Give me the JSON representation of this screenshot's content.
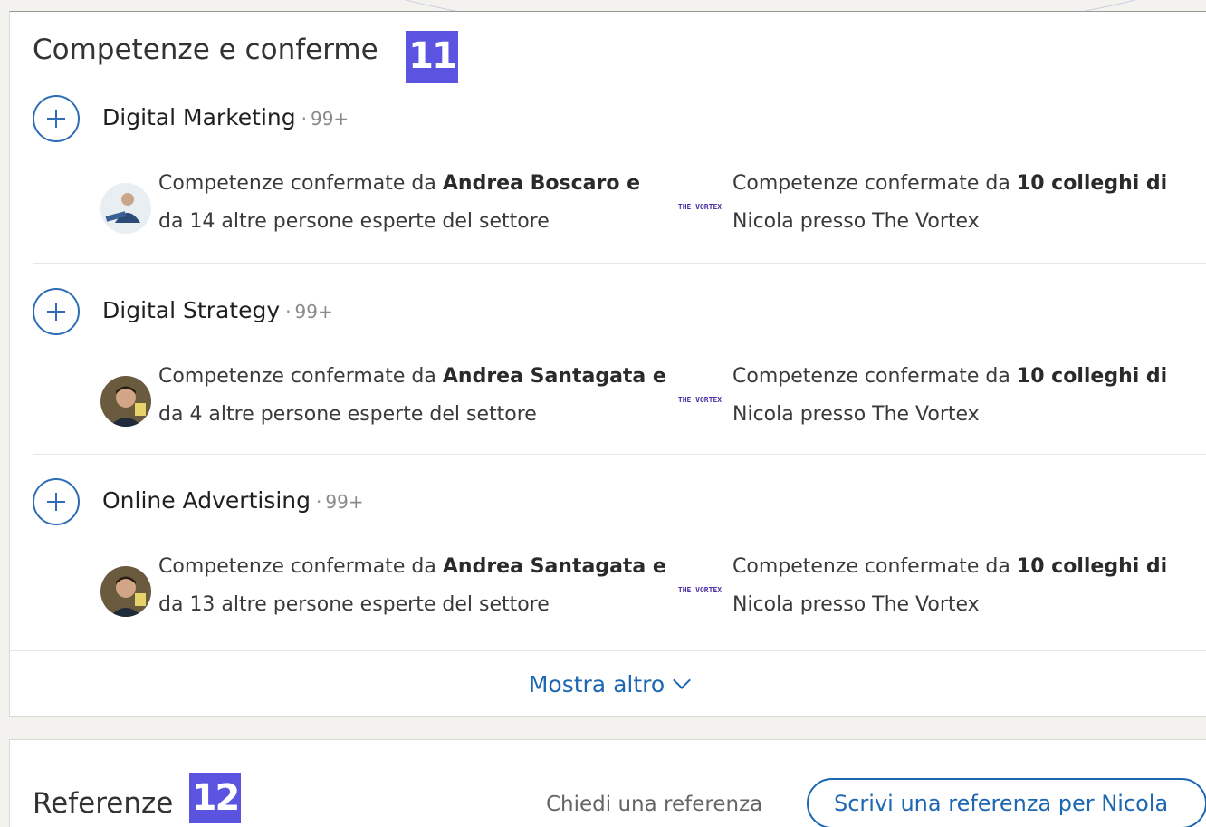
{
  "skills_section": {
    "title": "Competenze e conferme",
    "step_badge": "11",
    "skills": [
      {
        "name": "Digital Marketing",
        "count": "99+",
        "endorsement_left": {
          "prefix": "Competenze confermate da ",
          "person": "Andrea Boscaro e",
          "suffix": "da 14 altre persone esperte del settore"
        },
        "endorsement_right": {
          "prefix": "Competenze confermate da ",
          "bold": "10 colleghi di",
          "suffix": "Nicola presso The Vortex"
        },
        "logo_text": "THE VORTEX"
      },
      {
        "name": "Digital Strategy",
        "count": "99+",
        "endorsement_left": {
          "prefix": "Competenze confermate da ",
          "person": "Andrea Santagata e",
          "suffix": "da 4 altre persone esperte del settore"
        },
        "endorsement_right": {
          "prefix": "Competenze confermate da ",
          "bold": "10 colleghi di",
          "suffix": "Nicola presso The Vortex"
        },
        "logo_text": "THE VORTEX"
      },
      {
        "name": "Online Advertising",
        "count": "99+",
        "endorsement_left": {
          "prefix": "Competenze confermate da ",
          "person": "Andrea Santagata e",
          "suffix": "da 13 altre persone esperte del settore"
        },
        "endorsement_right": {
          "prefix": "Competenze confermate da ",
          "bold": "10 colleghi di",
          "suffix": "Nicola presso The Vortex"
        },
        "logo_text": "THE VORTEX"
      }
    ],
    "show_more_label": "Mostra altro"
  },
  "references_section": {
    "title": "Referenze",
    "step_badge": "12",
    "ask_label": "Chiedi una referenza",
    "write_label": "Scrivi una referenza per Nicola"
  },
  "colors": {
    "accent_blue": "#1d67b3",
    "badge_purple": "#5b54e0",
    "count_gray": "#8a8a8a"
  },
  "icons": {
    "add_skill": "plus-circle-icon",
    "show_more": "chevron-down-icon"
  }
}
